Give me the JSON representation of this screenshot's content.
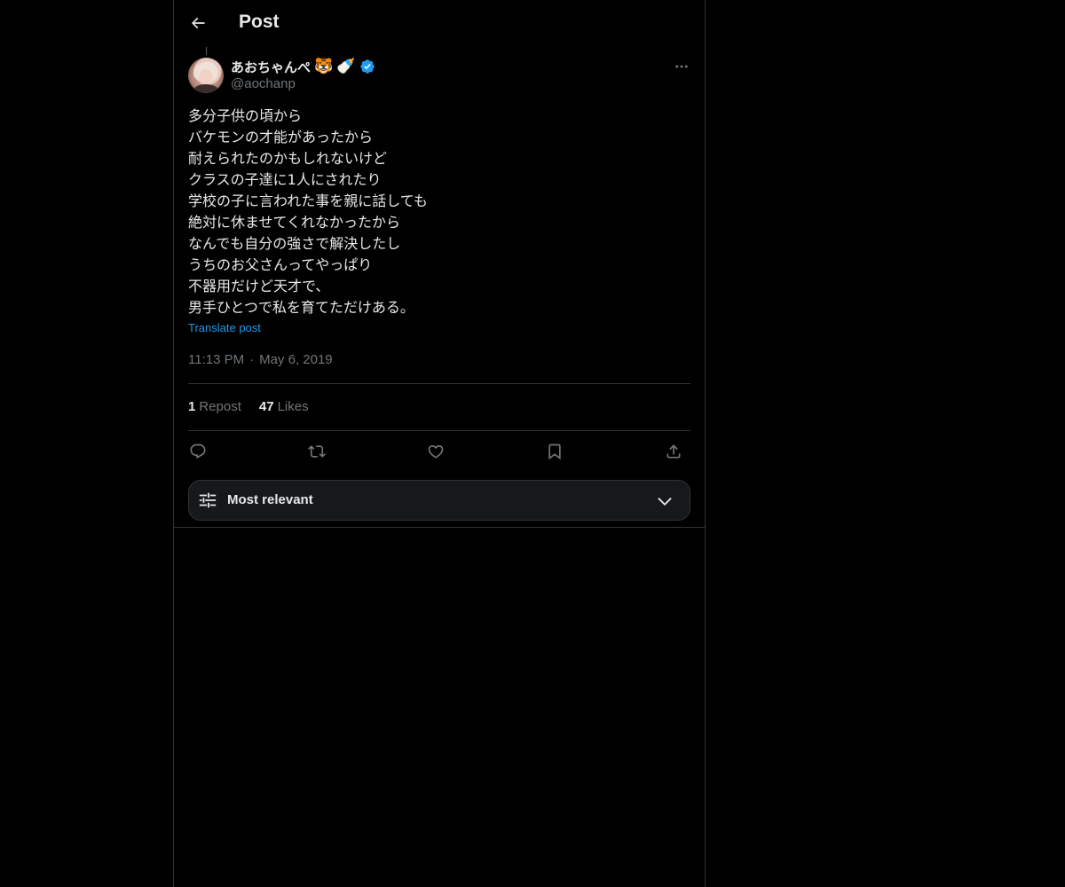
{
  "header": {
    "title": "Post",
    "back_icon": "arrow-left-icon"
  },
  "author": {
    "display_name": "あおちゃんぺ",
    "emojis": [
      "🐯",
      "🍼"
    ],
    "handle": "@aochanp",
    "verified": true,
    "verified_color": "#1d9bf0"
  },
  "post": {
    "text": "多分子供の頃から\nバケモンの才能があったから\n耐えられたのかもしれないけど\nクラスの子達に1人にされたり\n学校の子に言われた事を親に話しても\n絶対に休ませてくれなかったから\nなんでも自分の強さで解決したし\nうちのお父さんってやっぱり\n不器用だけど天才で、\n男手ひとつで私を育てただけある。",
    "translate_label": "Translate post",
    "time": "11:13 PM",
    "separator": "·",
    "date": "May 6, 2019"
  },
  "stats": {
    "reposts_count": "1",
    "reposts_label": "Repost",
    "likes_count": "47",
    "likes_label": "Likes"
  },
  "actions": [
    "reply-icon",
    "repost-icon",
    "like-icon",
    "bookmark-icon",
    "share-icon"
  ],
  "sort": {
    "label": "Most relevant",
    "icon": "sliders-icon",
    "chevron": "chevron-down-icon"
  },
  "colors": {
    "background": "#000000",
    "text": "#e7e9ea",
    "secondary_text": "#71767b",
    "accent": "#1d9bf0",
    "border": "#2f3336"
  }
}
